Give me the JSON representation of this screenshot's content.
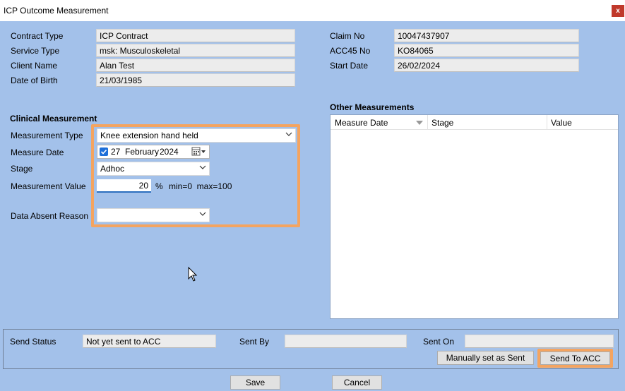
{
  "window": {
    "title": "ICP Outcome Measurement",
    "close_glyph": "x"
  },
  "details": {
    "contract_type_label": "Contract Type",
    "contract_type": "ICP Contract",
    "service_type_label": "Service Type",
    "service_type": "msk: Musculoskeletal",
    "client_name_label": "Client Name",
    "client_name": "Alan Test",
    "dob_label": "Date of Birth",
    "dob": "21/03/1985",
    "claim_no_label": "Claim No",
    "claim_no": "10047437907",
    "acc45_label": "ACC45 No",
    "acc45": "KO84065",
    "start_date_label": "Start Date",
    "start_date": "26/02/2024"
  },
  "clinical": {
    "heading": "Clinical Measurement",
    "type_label": "Measurement Type",
    "type_value": "Knee extension hand held",
    "date_label": "Measure Date",
    "date_day": "27",
    "date_month": "February",
    "date_year": "2024",
    "stage_label": "Stage",
    "stage_value": "Adhoc",
    "value_label": "Measurement Value",
    "value": "20",
    "unit": "%",
    "range": "min=0  max=100",
    "absent_label": "Data Absent Reason",
    "absent_value": ""
  },
  "other": {
    "heading": "Other Measurements",
    "columns": [
      "Measure Date",
      "Stage",
      "Value"
    ]
  },
  "send": {
    "status_label": "Send Status",
    "status_value": "Not yet sent to ACC",
    "sent_by_label": "Sent By",
    "sent_by_value": "",
    "sent_on_label": "Sent On",
    "sent_on_value": "",
    "manual_button": "Manually set as Sent",
    "send_button": "Send To ACC"
  },
  "footer": {
    "save": "Save",
    "cancel": "Cancel"
  },
  "colors": {
    "background": "#a3c1ea",
    "highlight": "#f4a460",
    "accent": "#1e6fd9"
  }
}
